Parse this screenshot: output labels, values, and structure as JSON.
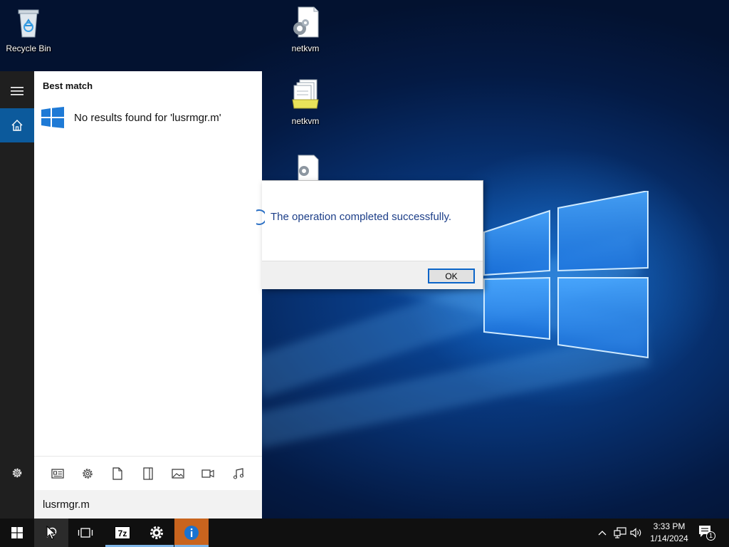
{
  "desktop": {
    "icons": [
      {
        "label": "Recycle Bin",
        "icon": "recycle-bin-icon"
      },
      {
        "label": "netkvm",
        "icon": "settings-file-icon"
      },
      {
        "label": "netkvm",
        "icon": "catalog-file-icon"
      },
      {
        "label": "",
        "icon": "settings-file-icon"
      }
    ]
  },
  "start_menu": {
    "rail": {
      "items": [
        {
          "icon": "hamburger-menu-icon"
        },
        {
          "icon": "home-icon",
          "active": true
        },
        {
          "icon": "gear-icon"
        }
      ]
    },
    "search": {
      "best_match_heading": "Best match",
      "result_text": "No results found for 'lusrmgr.m'",
      "filters": [
        {
          "icon": "apps-filter-icon"
        },
        {
          "icon": "settings-filter-icon"
        },
        {
          "icon": "documents-filter-icon"
        },
        {
          "icon": "folders-filter-icon"
        },
        {
          "icon": "photos-filter-icon"
        },
        {
          "icon": "videos-filter-icon"
        },
        {
          "icon": "music-filter-icon"
        }
      ],
      "query": "lusrmgr.m"
    }
  },
  "dialog": {
    "message": "The operation completed successfully.",
    "ok_label": "OK"
  },
  "taskbar": {
    "apps": [
      {
        "icon": "windows-start-icon"
      },
      {
        "icon": "search-icon",
        "highlighted": true
      },
      {
        "icon": "task-view-icon"
      },
      {
        "icon": "7zip-icon",
        "label": "7z",
        "running": true
      },
      {
        "icon": "settings-app-icon",
        "running": true
      },
      {
        "icon": "info-app-icon",
        "running": true
      }
    ],
    "tray": {
      "time": "3:33 PM",
      "date": "1/14/2024",
      "notification_count": "1"
    }
  },
  "colors": {
    "accent": "#0c5a9c",
    "dialog_text": "#1c3e88",
    "ok_border": "#0a64c8",
    "taskbar": "#101010",
    "info_app_bg": "#c8641e"
  }
}
